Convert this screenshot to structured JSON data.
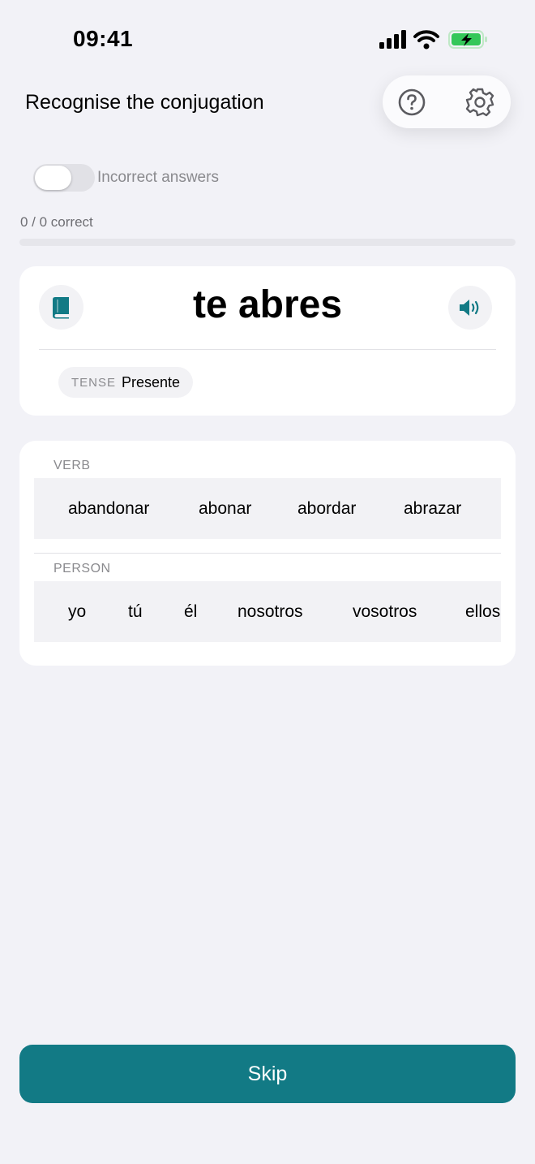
{
  "status_bar": {
    "time": "09:41",
    "icons": [
      "cellular-signal-icon",
      "wifi-icon",
      "battery-charging-icon"
    ]
  },
  "header": {
    "title": "Recognise the conjugation",
    "help_icon": "question-circle-icon",
    "settings_icon": "gear-icon"
  },
  "filter": {
    "toggle_label": "Incorrect answers",
    "toggle_on": false
  },
  "progress": {
    "text": "0 / 0 correct",
    "fraction": 0
  },
  "prompt": {
    "conjugation": "te abres",
    "book_icon": "book-icon",
    "audio_icon": "speaker-icon",
    "tense_key": "TENSE",
    "tense_value": "Presente"
  },
  "verb_picker": {
    "label": "VERB",
    "options": [
      "abandonar",
      "abonar",
      "abordar",
      "abrazar"
    ]
  },
  "person_picker": {
    "label": "PERSON",
    "options": [
      "yo",
      "tú",
      "él",
      "nosotros",
      "vosotros",
      "ellos"
    ]
  },
  "skip_button": {
    "label": "Skip"
  },
  "colors": {
    "accent": "#127a85",
    "background": "#f2f2f7",
    "card": "#ffffff",
    "muted_text": "#8a8a8e"
  }
}
